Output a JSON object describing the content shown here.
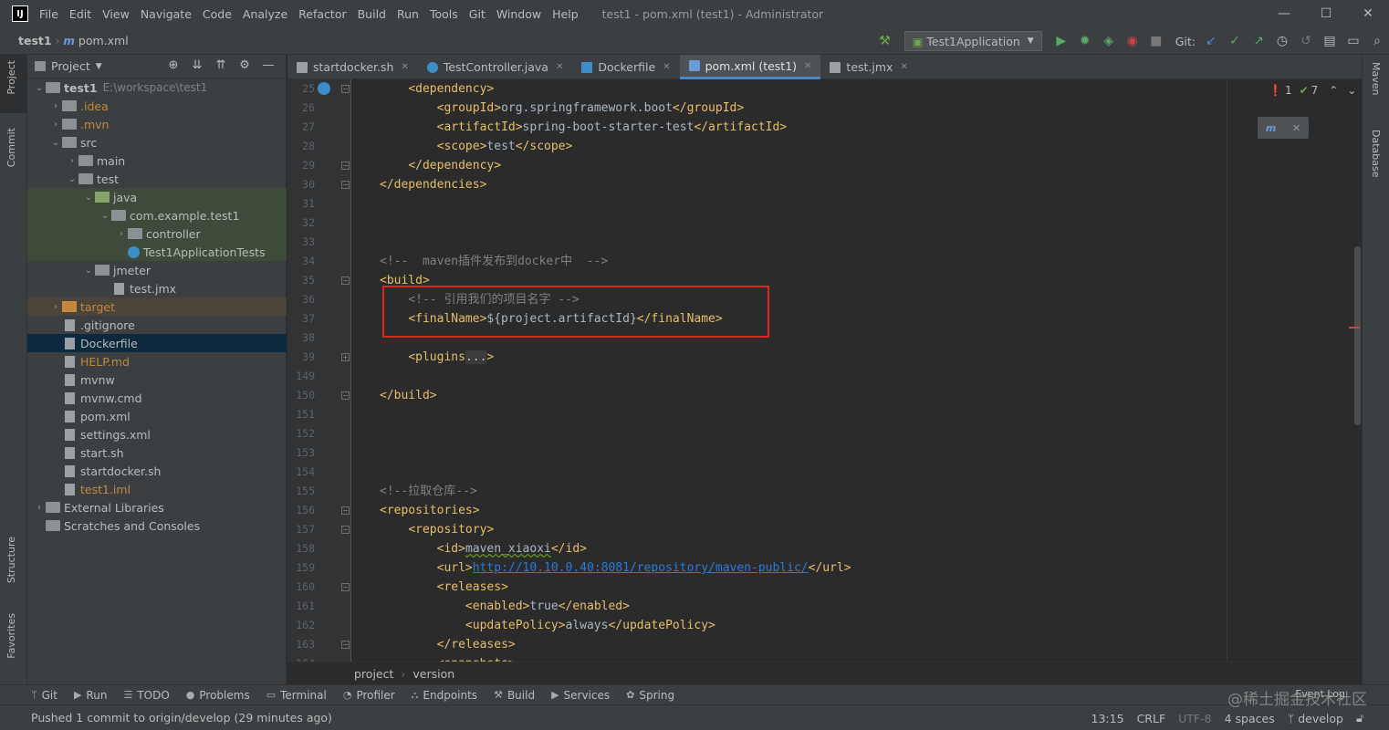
{
  "app": {
    "logo": "IJ",
    "window_title": "test1 - pom.xml (test1) - Administrator"
  },
  "menu": [
    "File",
    "Edit",
    "View",
    "Navigate",
    "Code",
    "Analyze",
    "Refactor",
    "Build",
    "Run",
    "Tools",
    "Git",
    "Window",
    "Help"
  ],
  "nav": {
    "project": "test1",
    "file": "pom.xml",
    "run_config": "Test1Application",
    "git_label": "Git:"
  },
  "project_panel": {
    "title": "Project"
  },
  "tree": [
    {
      "label": "test1",
      "path": "E:\\workspace\\test1",
      "depth": 0,
      "open": true,
      "kind": "folder",
      "bold": true
    },
    {
      "label": ".idea",
      "depth": 1,
      "open": false,
      "kind": "folder",
      "color": "#c5883a"
    },
    {
      "label": ".mvn",
      "depth": 1,
      "open": false,
      "kind": "folder",
      "color": "#c5883a"
    },
    {
      "label": "src",
      "depth": 1,
      "open": true,
      "kind": "folder"
    },
    {
      "label": "main",
      "depth": 2,
      "open": false,
      "kind": "folder"
    },
    {
      "label": "test",
      "depth": 2,
      "open": true,
      "kind": "folder"
    },
    {
      "label": "java",
      "depth": 3,
      "open": true,
      "kind": "folderg",
      "hl": true
    },
    {
      "label": "com.example.test1",
      "depth": 4,
      "open": true,
      "kind": "folder",
      "hl": true
    },
    {
      "label": "controller",
      "depth": 5,
      "open": false,
      "kind": "folder",
      "hl": true
    },
    {
      "label": "Test1ApplicationTests",
      "depth": 5,
      "kind": "class",
      "hl": true
    },
    {
      "label": "jmeter",
      "depth": 3,
      "open": true,
      "kind": "folder"
    },
    {
      "label": "test.jmx",
      "depth": 4,
      "kind": "file"
    },
    {
      "label": "target",
      "depth": 1,
      "open": false,
      "kind": "foldero",
      "color": "#c5883a",
      "hlo": true
    },
    {
      "label": ".gitignore",
      "depth": 1,
      "kind": "file"
    },
    {
      "label": "Dockerfile",
      "depth": 1,
      "kind": "file",
      "selected": true
    },
    {
      "label": "HELP.md",
      "depth": 1,
      "kind": "file",
      "color": "#c5883a"
    },
    {
      "label": "mvnw",
      "depth": 1,
      "kind": "file"
    },
    {
      "label": "mvnw.cmd",
      "depth": 1,
      "kind": "file"
    },
    {
      "label": "pom.xml",
      "depth": 1,
      "kind": "file"
    },
    {
      "label": "settings.xml",
      "depth": 1,
      "kind": "file"
    },
    {
      "label": "start.sh",
      "depth": 1,
      "kind": "file"
    },
    {
      "label": "startdocker.sh",
      "depth": 1,
      "kind": "file"
    },
    {
      "label": "test1.iml",
      "depth": 1,
      "kind": "file",
      "color": "#c5883a"
    },
    {
      "label": "External Libraries",
      "depth": 0,
      "open": false,
      "kind": "lib"
    },
    {
      "label": "Scratches and Consoles",
      "depth": 0,
      "kind": "scratch"
    }
  ],
  "tabs": [
    {
      "label": "startdocker.sh",
      "active": false
    },
    {
      "label": "TestController.java",
      "active": false
    },
    {
      "label": "Dockerfile",
      "active": false
    },
    {
      "label": "pom.xml (test1)",
      "active": true
    },
    {
      "label": "test.jmx",
      "active": false
    }
  ],
  "code_lines": [
    {
      "n": "25",
      "text": "    <dependency>"
    },
    {
      "n": "26",
      "text": "        <groupId>org.springframework.boot</groupId>"
    },
    {
      "n": "27",
      "text": "        <artifactId>spring-boot-starter-test</artifactId>"
    },
    {
      "n": "28",
      "text": "        <scope>test</scope>"
    },
    {
      "n": "29",
      "text": "    </dependency>"
    },
    {
      "n": "30",
      "text": "</dependencies>"
    },
    {
      "n": "31",
      "text": ""
    },
    {
      "n": "32",
      "text": ""
    },
    {
      "n": "33",
      "text": ""
    },
    {
      "n": "34",
      "text": "<!--  maven插件发布到docker中  -->"
    },
    {
      "n": "35",
      "text": "<build>"
    },
    {
      "n": "36",
      "text": "    <!-- 引用我们的项目名字 -->"
    },
    {
      "n": "37",
      "text": "    <finalName>${project.artifactId}</finalName>"
    },
    {
      "n": "38",
      "text": ""
    },
    {
      "n": "39",
      "text": "    <plugins...>"
    },
    {
      "n": "149",
      "text": ""
    },
    {
      "n": "150",
      "text": "</build>"
    },
    {
      "n": "151",
      "text": ""
    },
    {
      "n": "152",
      "text": ""
    },
    {
      "n": "153",
      "text": ""
    },
    {
      "n": "154",
      "text": ""
    },
    {
      "n": "155",
      "text": "<!--拉取仓库-->"
    },
    {
      "n": "156",
      "text": "<repositories>"
    },
    {
      "n": "157",
      "text": "    <repository>"
    },
    {
      "n": "158",
      "text": "        <id>maven_xiaoxi</id>"
    },
    {
      "n": "159",
      "text": "        <url>http://10.10.0.40:8081/repository/maven-public/</url>"
    },
    {
      "n": "160",
      "text": "        <releases>"
    },
    {
      "n": "161",
      "text": "            <enabled>true</enabled>"
    },
    {
      "n": "162",
      "text": "            <updatePolicy>always</updatePolicy>"
    },
    {
      "n": "163",
      "text": "        </releases>"
    },
    {
      "n": "164",
      "text": "        <snapshots>"
    }
  ],
  "inspections": {
    "errors": "1",
    "warnings": "7"
  },
  "breadcrumb": [
    "project",
    "version"
  ],
  "left_tabs": [
    "Project",
    "Commit",
    "Structure",
    "Favorites"
  ],
  "right_tabs": [
    "Maven",
    "Database"
  ],
  "bottom_tabs": [
    "Git",
    "Run",
    "TODO",
    "Problems",
    "Terminal",
    "Profiler",
    "Endpoints",
    "Build",
    "Services",
    "Spring"
  ],
  "status": {
    "message": "Pushed 1 commit to origin/develop (29 minutes ago)",
    "position": "13:15",
    "line_sep": "CRLF",
    "encoding": "UTF-8",
    "indent": "4 spaces",
    "branch": "develop",
    "event_log": "Event Log"
  },
  "watermark": "@稀土掘金技术社区",
  "colors": {
    "tag": "#e8bf6a",
    "comment": "#808080",
    "text": "#a9b7c6",
    "url": "#287bde",
    "highlight_box": "#e0231f"
  }
}
